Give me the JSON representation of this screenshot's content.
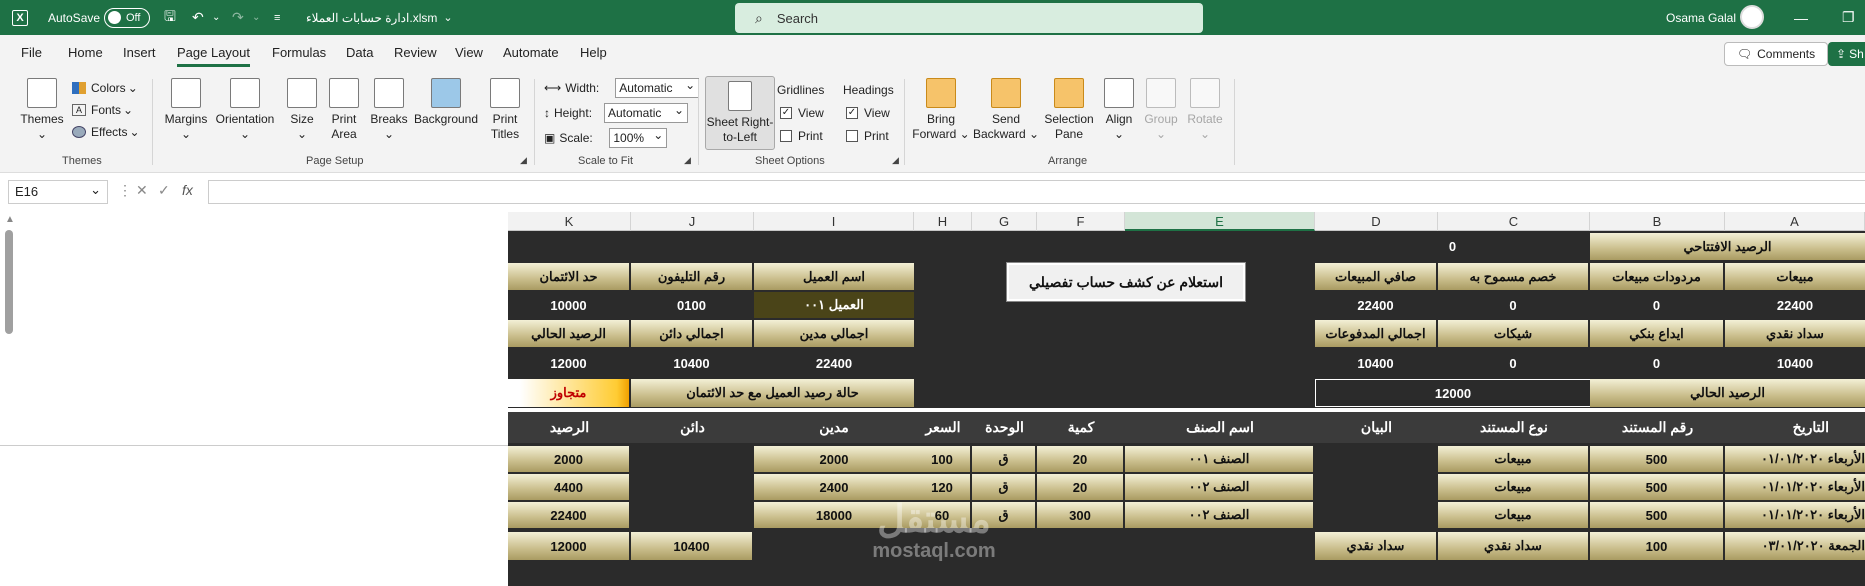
{
  "titlebar": {
    "autosave_label": "AutoSave",
    "autosave_state": "Off",
    "file_name": "ادارة حسابات العملاء.xlsm",
    "search_placeholder": "Search",
    "user_name": "Osama Galal"
  },
  "menu": {
    "tabs": [
      "File",
      "Home",
      "Insert",
      "Page Layout",
      "Formulas",
      "Data",
      "Review",
      "View",
      "Automate",
      "Help"
    ],
    "active_tab": "Page Layout",
    "comments_label": "Comments",
    "share_label": "Sh"
  },
  "ribbon": {
    "themes": {
      "themes_label": "Themes",
      "colors_label": "Colors",
      "fonts_label": "Fonts",
      "effects_label": "Effects",
      "group_label": "Themes"
    },
    "page_setup": {
      "margins": "Margins",
      "orientation": "Orientation",
      "size": "Size",
      "print_area_1": "Print",
      "print_area_2": "Area",
      "breaks": "Breaks",
      "background": "Background",
      "print_titles_1": "Print",
      "print_titles_2": "Titles",
      "group_label": "Page Setup"
    },
    "scale_to_fit": {
      "width_label": "Width:",
      "width_value": "Automatic",
      "height_label": "Height:",
      "height_value": "Automatic",
      "scale_label": "Scale:",
      "scale_value": "100%",
      "group_label": "Scale to Fit"
    },
    "sheet_options": {
      "rtl_1": "Sheet Right-",
      "rtl_2": "to-Left",
      "gridlines": "Gridlines",
      "headings": "Headings",
      "view": "View",
      "print": "Print",
      "group_label": "Sheet Options"
    },
    "arrange": {
      "bring_1": "Bring",
      "bring_2": "Forward",
      "send_1": "Send",
      "send_2": "Backward",
      "selection_1": "Selection",
      "selection_2": "Pane",
      "align": "Align",
      "group": "Group",
      "rotate": "Rotate",
      "group_label": "Arrange"
    }
  },
  "formula_bar": {
    "name_box": "E16",
    "fx": "fx",
    "formula": ""
  },
  "columns": [
    "K",
    "J",
    "I",
    "H",
    "G",
    "F",
    "E",
    "D",
    "C",
    "B",
    "A"
  ],
  "selected_column": "E",
  "sheet": {
    "inquiry_button": "استعلام عن كشف حساب تفصيلي",
    "opening_balance_label": "الرصيد الافتتاحي",
    "opening_balance_value": "0",
    "summary_headers": [
      "صافي المبيعات",
      "خصم مسموح به",
      "مردودات مبيعات",
      "مبيعات"
    ],
    "summary_values": [
      "22400",
      "0",
      "0",
      "22400"
    ],
    "payment_headers": [
      "اجمالي المدفوعات",
      "شيكات",
      "ايداع بنكي",
      "سداد نقدي"
    ],
    "payment_values": [
      "10400",
      "0",
      "0",
      "10400"
    ],
    "current_balance_label": "الرصيد الحالي",
    "current_balance_value": "12000",
    "customer_headers": [
      "حد الائتمان",
      "رقم التليفون",
      "اسم العميل"
    ],
    "customer_values": [
      "10000",
      "0100",
      "العميل ٠٠١"
    ],
    "totals_headers": [
      "الرصيد الحالي",
      "اجمالي دائن",
      "اجمالي مدين"
    ],
    "totals_values": [
      "12000",
      "10400",
      "22400"
    ],
    "status_label": "حالة رصيد العميل مع حد الائتمان",
    "status_value": "متجاوز",
    "table_headers": [
      "الرصيد",
      "دائن",
      "مدين",
      "السعر",
      "الوحدة",
      "كمية",
      "اسم الصنف",
      "البيان",
      "نوع المستند",
      "رقم المستند",
      "التاريخ"
    ],
    "rows": [
      {
        "balance": "2000",
        "credit": "",
        "debit": "2000",
        "price": "100",
        "unit": "ق",
        "qty": "20",
        "item": "الصنف ٠٠١",
        "desc": "",
        "doc_type": "مبيعات",
        "doc_no": "500",
        "date": "الأربعاء ٠١/٠١/٢٠٢٠"
      },
      {
        "balance": "4400",
        "credit": "",
        "debit": "2400",
        "price": "120",
        "unit": "ق",
        "qty": "20",
        "item": "الصنف ٠٠٢",
        "desc": "",
        "doc_type": "مبيعات",
        "doc_no": "500",
        "date": "الأربعاء ٠١/٠١/٢٠٢٠"
      },
      {
        "balance": "22400",
        "credit": "",
        "debit": "18000",
        "price": "60",
        "unit": "ق",
        "qty": "300",
        "item": "الصنف ٠٠٢",
        "desc": "",
        "doc_type": "مبيعات",
        "doc_no": "500",
        "date": "الأربعاء ٠١/٠١/٢٠٢٠"
      },
      {
        "balance": "12000",
        "credit": "10400",
        "debit": "",
        "price": "",
        "unit": "",
        "qty": "",
        "item": "",
        "desc": "سداد نقدي",
        "doc_type": "سداد نقدي",
        "doc_no": "100",
        "date": "الجمعة ٠٣/٠١/٢٠٢٠"
      }
    ]
  },
  "watermark": {
    "arabic": "مستقل",
    "latin": "mostaql.com"
  }
}
